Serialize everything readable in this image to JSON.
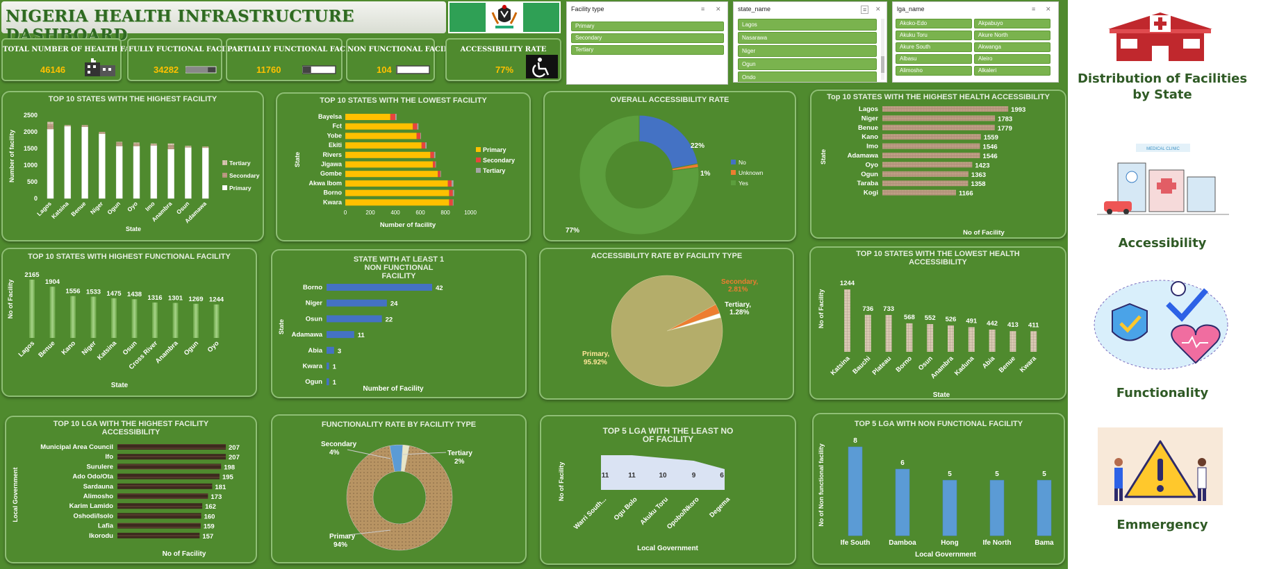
{
  "dashboard": {
    "title": "NIGERIA HEALTH INFRASTRUCTURE DASHBOARD"
  },
  "kpis": [
    {
      "label": "TOTAL NUMBER OF HEALTH FACILITIES",
      "value": "46146",
      "icon": "hospital-building-icon"
    },
    {
      "label": "FULLY FUCTIONAL FACILITY",
      "value": "34282",
      "icon": "progress-bar-icon"
    },
    {
      "label": "PARTIALLY FUNCTIONAL FACILITY",
      "value": "11760",
      "icon": "progress-bar-icon"
    },
    {
      "label": "NON FUNCTIONAL FACILITY",
      "value": "104",
      "icon": "progress-bar-icon"
    },
    {
      "label": "ACCESSIBILITY RATE",
      "value": "77%",
      "icon": "wheelchair-icon"
    }
  ],
  "slicers": {
    "facility_type": {
      "header": "Facility type",
      "items": [
        "Primary",
        "Secondary",
        "Tertiary"
      ]
    },
    "state_name": {
      "header": "state_name",
      "items": [
        "Lagos",
        "Nasarawa",
        "Niger",
        "Ogun",
        "Ondo"
      ]
    },
    "lga_name": {
      "header": "lga_name",
      "items": [
        "Akoko-Edo",
        "Akpabuyo",
        "Akuku Toru",
        "Akure North",
        "Akure South",
        "Akwanga",
        "Albasu",
        "Aleiro",
        "Alimosho",
        "Alkaleri"
      ]
    }
  },
  "side_nav": {
    "items": [
      "Distribution of Facilities by State",
      "Accessibility",
      "Functionality",
      "Emmergency"
    ],
    "badge_text": "MEDICAL CLINIC"
  },
  "colors": {
    "background": "#4f8a2e",
    "primary": "#ffc000",
    "blue": "#4472c4",
    "orange": "#ed7d31",
    "gray": "#a5a5a5"
  },
  "chart_data": [
    {
      "id": "top10_highest_facility",
      "type": "bar",
      "stacked": true,
      "title": "TOP 10 STATES WITH THE HIGHEST FACILITY",
      "xlabel": "State",
      "ylabel": "Number of facility",
      "categories": [
        "Lagos",
        "Katsina",
        "Benue",
        "Niger",
        "Ogun",
        "Oyo",
        "Imo",
        "Anambra",
        "Osun",
        "Adamawa"
      ],
      "series": [
        {
          "name": "Primary",
          "values": [
            2080,
            2170,
            2150,
            1940,
            1570,
            1570,
            1590,
            1480,
            1530,
            1520
          ]
        },
        {
          "name": "Secondary",
          "values": [
            150,
            20,
            45,
            50,
            110,
            80,
            40,
            120,
            30,
            30
          ]
        },
        {
          "name": "Tertiary",
          "values": [
            70,
            15,
            10,
            10,
            20,
            30,
            20,
            50,
            20,
            10
          ]
        }
      ],
      "ylim": [
        0,
        2500
      ],
      "yticks": [
        "0",
        "500",
        "1000",
        "1500",
        "2000",
        "2500"
      ],
      "legend": "right"
    },
    {
      "id": "top10_lowest_facility",
      "type": "bar",
      "orientation": "horizontal",
      "stacked": true,
      "title": "TOP 10 STATES WITH THE LOWEST FACILITY",
      "xlabel": "Number of facility",
      "ylabel": "State",
      "categories": [
        "Bayelsa",
        "Fct",
        "Yobe",
        "Ekiti",
        "Rivers",
        "Jigawa",
        "Gombe",
        "Akwa Ibom",
        "Borno",
        "Kwara"
      ],
      "series": [
        {
          "name": "Primary",
          "values": [
            360,
            540,
            570,
            610,
            680,
            700,
            740,
            820,
            830,
            830
          ]
        },
        {
          "name": "Secondary",
          "values": [
            40,
            35,
            30,
            30,
            30,
            20,
            20,
            30,
            30,
            30
          ]
        },
        {
          "name": "Tertiary",
          "values": [
            10,
            10,
            5,
            10,
            10,
            5,
            5,
            15,
            10,
            5
          ]
        }
      ],
      "xlim": [
        0,
        1000
      ],
      "xticks": [
        "0",
        "200",
        "400",
        "600",
        "800",
        "1000"
      ],
      "legend": "right"
    },
    {
      "id": "overall_accessibility",
      "type": "pie",
      "donut": true,
      "title": "OVERALL ACCESSIBILITY RATE",
      "series": [
        {
          "name": "No",
          "value": 22,
          "label": "22%"
        },
        {
          "name": "Unknown",
          "value": 1,
          "label": "1%"
        },
        {
          "name": "Yes",
          "value": 77,
          "label": "77%"
        }
      ],
      "legend": "right"
    },
    {
      "id": "top10_highest_access",
      "type": "bar",
      "orientation": "horizontal",
      "title": "Top 10 STATES WITH THE HIGHEST HEALTH ACCESSIBILITY",
      "xlabel": "No of Facility",
      "ylabel": "State",
      "categories": [
        "Lagos",
        "Niger",
        "Benue",
        "Kano",
        "Imo",
        "Adamawa",
        "Oyo",
        "Ogun",
        "Taraba",
        "Kogi"
      ],
      "values": [
        1993,
        1783,
        1779,
        1559,
        1546,
        1546,
        1423,
        1363,
        1358,
        1166
      ]
    },
    {
      "id": "top10_functional",
      "type": "bar",
      "title": "TOP 10 STATES WITH HIGHEST FUNCTIONAL FACILITY",
      "xlabel": "State",
      "ylabel": "No of Facility",
      "categories": [
        "Lagos",
        "Benue",
        "Kano",
        "Niger",
        "Katsina",
        "Osun",
        "Cross River",
        "Anambra",
        "Ogun",
        "Oyo"
      ],
      "values": [
        2165,
        1904,
        1556,
        1533,
        1475,
        1438,
        1316,
        1301,
        1269,
        1244
      ]
    },
    {
      "id": "non_functional_states",
      "type": "bar",
      "orientation": "horizontal",
      "title": "STATE WITH AT LEAST 1 NON FUNCTIONAL FACILITY",
      "xlabel": "Number of Facility",
      "ylabel": "State",
      "categories": [
        "Borno",
        "Niger",
        "Osun",
        "Adamawa",
        "Abia",
        "Kwara",
        "Ogun"
      ],
      "values": [
        42,
        24,
        22,
        11,
        3,
        1,
        1
      ]
    },
    {
      "id": "access_by_type",
      "type": "pie",
      "title": "ACCESSIBILITY RATE BY FACILITY TYPE",
      "series": [
        {
          "name": "Primary",
          "value": 95.92,
          "label": "Primary,",
          "pct": "95.92%"
        },
        {
          "name": "Secondary",
          "value": 2.81,
          "label": "Secondary,",
          "pct": "2.81%"
        },
        {
          "name": "Tertiary",
          "value": 1.28,
          "label": "Tertiary,",
          "pct": "1.28%"
        }
      ]
    },
    {
      "id": "top10_lowest_access",
      "type": "bar",
      "title": "TOP 10 STATES WITH THE LOWEST HEALTH ACCESSIBILITY",
      "xlabel": "State",
      "ylabel": "No of Facility",
      "categories": [
        "Katsina",
        "Bauchi",
        "Plateau",
        "Borno",
        "Osun",
        "Anambra",
        "Kaduna",
        "Abia",
        "Benue",
        "Kwara"
      ],
      "values": [
        1244,
        736,
        733,
        568,
        552,
        526,
        491,
        442,
        413,
        411
      ]
    },
    {
      "id": "top10_lga_access",
      "type": "bar",
      "orientation": "horizontal",
      "title": "TOP 10 LGA WITH THE HIGHEST FACILITY ACCESSIBILITY",
      "xlabel": "No of Facility",
      "ylabel": "Local Government",
      "categories": [
        "Municipal Area Council",
        "Ifo",
        "Surulere",
        "Ado Odo/Ota",
        "Sardauna",
        "Alimosho",
        "Karim Lamido",
        "Oshodi/Isolo",
        "Lafia",
        "Ikorodu"
      ],
      "values": [
        207,
        207,
        198,
        195,
        181,
        173,
        162,
        160,
        159,
        157
      ]
    },
    {
      "id": "functionality_by_type",
      "type": "pie",
      "donut": true,
      "title": "FUNCTIONALITY RATE BY FACILITY TYPE",
      "series": [
        {
          "name": "Primary",
          "value": 94,
          "label": "Primary",
          "pct": "94%"
        },
        {
          "name": "Secondary",
          "value": 4,
          "label": "Secondary",
          "pct": "4%"
        },
        {
          "name": "Tertiary",
          "value": 2,
          "label": "Tertiary",
          "pct": "2%"
        }
      ]
    },
    {
      "id": "least_lga",
      "type": "area",
      "title": "TOP 5 LGA WITH THE LEAST NO OF FACILITY",
      "xlabel": "Local Government",
      "ylabel": "No of Facility",
      "categories": [
        "Warri South...",
        "Ogu Bolo",
        "Akuku Toru",
        "Opobo/Nkoro",
        "Degema"
      ],
      "values": [
        11,
        11,
        10,
        9,
        6
      ]
    },
    {
      "id": "lga_non_functional",
      "type": "bar",
      "title": "TOP 5 LGA WITH NON FUNCTIONAL FACILITY",
      "xlabel": "Local Government",
      "ylabel": "No of Non functional facility",
      "categories": [
        "Ife South",
        "Damboa",
        "Hong",
        "Ife North",
        "Bama"
      ],
      "values": [
        8,
        6,
        5,
        5,
        5
      ]
    }
  ]
}
